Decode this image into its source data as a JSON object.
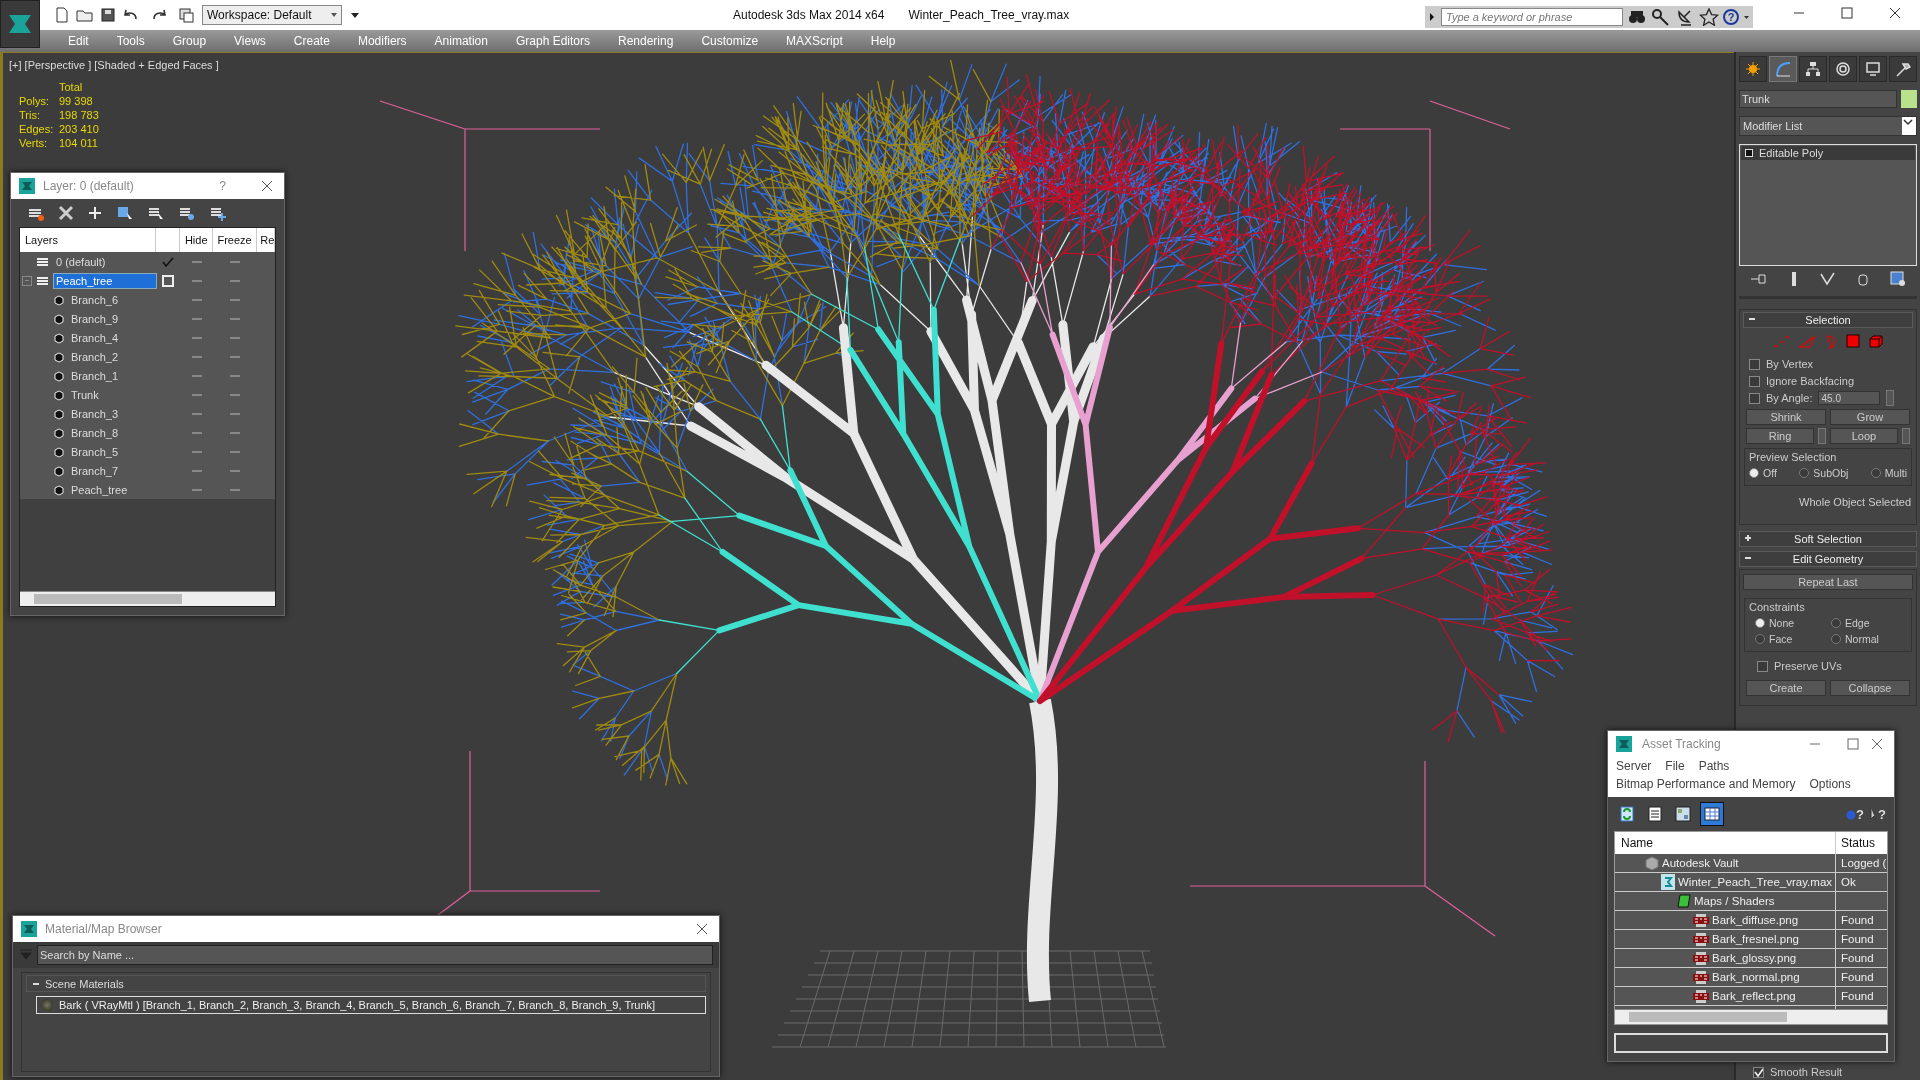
{
  "title_bar": {
    "workspace": "Workspace: Default",
    "app": "Autodesk 3ds Max  2014 x64",
    "file": "Winter_Peach_Tree_vray.max",
    "search_placeholder": "Type a keyword or phrase",
    "help_mark": "?"
  },
  "menu": [
    "Edit",
    "Tools",
    "Group",
    "Views",
    "Create",
    "Modifiers",
    "Animation",
    "Graph Editors",
    "Rendering",
    "Customize",
    "MAXScript",
    "Help"
  ],
  "viewport": {
    "label": "[+] [Perspective ] [Shaded + Edged Faces ]",
    "stats_header": "Total",
    "stats": [
      {
        "label": "Polys:",
        "value": "99 398"
      },
      {
        "label": "Tris:",
        "value": "198 783"
      },
      {
        "label": "Edges:",
        "value": "203 410"
      },
      {
        "label": "Verts:",
        "value": "104 011"
      }
    ]
  },
  "layer_window": {
    "title": "Layer: 0 (default)",
    "help": "?",
    "columns": [
      "Layers",
      "Hide",
      "Freeze",
      "Re"
    ],
    "layers": [
      {
        "name": "0 (default)",
        "selected": false,
        "current": true
      },
      {
        "name": "Peach_tree",
        "selected": true,
        "current": false,
        "children": [
          {
            "name": "Branch_6"
          },
          {
            "name": "Branch_9"
          },
          {
            "name": "Branch_4"
          },
          {
            "name": "Branch_2"
          },
          {
            "name": "Branch_1"
          },
          {
            "name": "Trunk"
          },
          {
            "name": "Branch_3"
          },
          {
            "name": "Branch_8"
          },
          {
            "name": "Branch_5"
          },
          {
            "name": "Branch_7"
          },
          {
            "name": "Peach_tree"
          }
        ]
      }
    ]
  },
  "command_panel": {
    "tabs": [
      {
        "kind": "create",
        "selected": false
      },
      {
        "kind": "modify",
        "selected": true
      },
      {
        "kind": "hierarchy",
        "selected": false
      },
      {
        "kind": "motion",
        "selected": false
      },
      {
        "kind": "display",
        "selected": false
      },
      {
        "kind": "utilities",
        "selected": false
      }
    ],
    "object_name": "Trunk",
    "modifier_list": "Modifier List",
    "stack": [
      "Editable Poly"
    ],
    "selection": {
      "title": "Selection",
      "expanded": true,
      "checkboxes": [
        {
          "label": "By Vertex",
          "checked": false
        },
        {
          "label": "Ignore Backfacing",
          "checked": false
        }
      ],
      "by_angle": {
        "label": "By Angle:",
        "checked": false,
        "value": "45.0"
      },
      "buttons": [
        "Shrink",
        "Grow"
      ],
      "spinner_buttons": [
        "Ring",
        "Loop"
      ],
      "preview": {
        "title": "Preview Selection",
        "options": [
          {
            "label": "Off",
            "selected": true
          },
          {
            "label": "SubObj",
            "selected": false
          },
          {
            "label": "Multi",
            "selected": false
          }
        ]
      },
      "status": "Whole Object Selected"
    },
    "soft_selection": {
      "title": "Soft Selection",
      "expanded": false
    },
    "edit_geometry": {
      "title": "Edit Geometry",
      "expanded": true,
      "repeat": "Repeat Last",
      "constraints": {
        "title": "Constraints",
        "options": [
          {
            "label": "None",
            "selected": true
          },
          {
            "label": "Edge",
            "selected": false
          },
          {
            "label": "Face",
            "selected": false
          },
          {
            "label": "Normal",
            "selected": false
          }
        ]
      },
      "preserve_uvs": {
        "label": "Preserve UVs",
        "checked": false
      },
      "buttons": [
        "Create",
        "Collapse"
      ]
    },
    "smooth_result": {
      "label": "Smooth Result",
      "checked": true
    }
  },
  "material_browser": {
    "title": "Material/Map Browser",
    "search_placeholder": "Search by Name ...",
    "group": "Scene Materials",
    "items": [
      "Bark  ( VRayMtl )  [Branch_1, Branch_2, Branch_3, Branch_4, Branch_5, Branch_6, Branch_7, Branch_8, Branch_9, Trunk]"
    ]
  },
  "asset_tracking": {
    "title": "Asset Tracking",
    "menus": [
      "Server",
      "File",
      "Paths",
      "Bitmap Performance and Memory",
      "Options"
    ],
    "views": [
      {
        "kind": "refresh",
        "selected": false
      },
      {
        "kind": "list",
        "selected": false
      },
      {
        "kind": "thumbs",
        "selected": false
      },
      {
        "kind": "table",
        "selected": true
      }
    ],
    "help_marks": [
      "?",
      "?"
    ],
    "columns": [
      "Name",
      "Status"
    ],
    "rows": [
      {
        "kind": "vault",
        "name": "Autodesk Vault",
        "status": "Logged (",
        "children": [
          {
            "kind": "scene",
            "name": "Winter_Peach_Tree_vray.max",
            "status": "Ok",
            "children": [
              {
                "kind": "folder",
                "name": "Maps / Shaders",
                "children": [
                  {
                    "kind": "png",
                    "name": "Bark_diffuse.png",
                    "status": "Found"
                  },
                  {
                    "kind": "png",
                    "name": "Bark_fresnel.png",
                    "status": "Found"
                  },
                  {
                    "kind": "png",
                    "name": "Bark_glossy.png",
                    "status": "Found"
                  },
                  {
                    "kind": "png",
                    "name": "Bark_normal.png",
                    "status": "Found"
                  },
                  {
                    "kind": "png",
                    "name": "Bark_reflect.png",
                    "status": "Found"
                  }
                ]
              }
            ]
          }
        ]
      }
    ]
  }
}
